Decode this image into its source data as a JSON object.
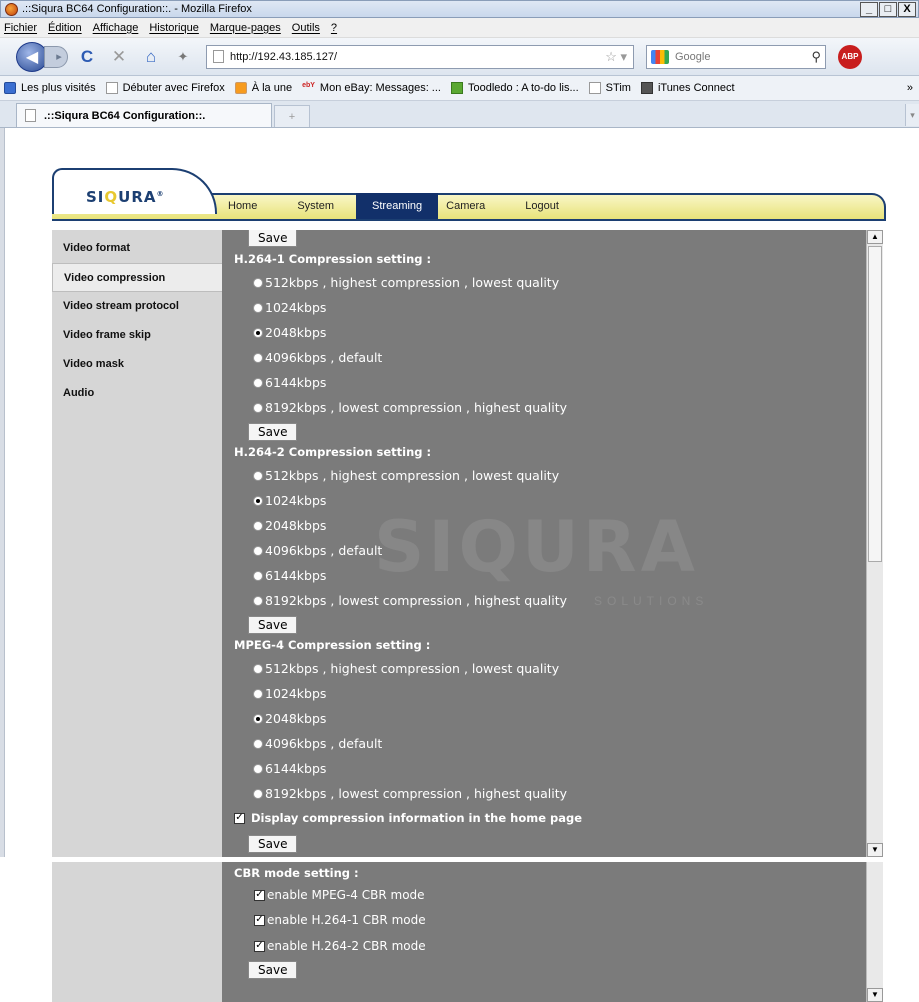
{
  "window": {
    "title": ".::Siqura BC64 Configuration::. - Mozilla Firefox",
    "buttons": [
      "_",
      "□",
      "X"
    ]
  },
  "menu": [
    "Fichier",
    "Édition",
    "Affichage",
    "Historique",
    "Marque-pages",
    "Outils",
    "?"
  ],
  "nav": {
    "url": "http://192.43.185.127/",
    "search_placeholder": "Google",
    "abp": "ABP"
  },
  "bookmarks": [
    "Les plus visités",
    "Débuter avec Firefox",
    "À la une",
    "Mon eBay: Messages: ...",
    "Toodledo : A to-do lis...",
    "STim",
    "iTunes Connect",
    "»"
  ],
  "bookmark_prefix_ebay": "ebY",
  "tab": {
    "title": ".::Siqura BC64 Configuration::.",
    "new_tab": "+"
  },
  "header": {
    "logo_prefix": "SI",
    "logo_q": "Q",
    "logo_suffix": "URA",
    "logo_mark": "®",
    "nav": [
      "Home",
      "System",
      "Streaming",
      "Camera",
      "Logout"
    ],
    "active_nav": "Streaming"
  },
  "sidebar": [
    "Video format",
    "Video compression",
    "Video stream protocol",
    "Video frame skip",
    "Video mask",
    "Audio"
  ],
  "sidebar_active": "Video compression",
  "watermark": {
    "text": "SIQURA",
    "sub": "SOLUTIONS"
  },
  "save_label": "Save",
  "sections": [
    {
      "heading": "H.264-1 Compression setting :",
      "selected": 2,
      "options": [
        "512kbps , highest compression , lowest quality",
        "1024kbps",
        "2048kbps",
        "4096kbps , default",
        "6144kbps",
        "8192kbps , lowest compression , highest quality"
      ]
    },
    {
      "heading": "H.264-2 Compression setting :",
      "selected": 1,
      "options": [
        "512kbps , highest compression , lowest quality",
        "1024kbps",
        "2048kbps",
        "4096kbps , default",
        "6144kbps",
        "8192kbps , lowest compression , highest quality"
      ]
    },
    {
      "heading": "MPEG-4 Compression setting :",
      "selected": 2,
      "options": [
        "512kbps , highest compression , lowest quality",
        "1024kbps",
        "2048kbps",
        "4096kbps , default",
        "6144kbps",
        "8192kbps , lowest compression , highest quality"
      ]
    }
  ],
  "display_info": {
    "label": "Display compression information in the home page",
    "checked": true
  },
  "cbr": {
    "heading": "CBR mode setting :",
    "options": [
      {
        "label": "enable MPEG-4 CBR mode",
        "checked": true
      },
      {
        "label": "enable H.264-1 CBR mode",
        "checked": true
      },
      {
        "label": "enable H.264-2 CBR mode",
        "checked": true
      }
    ]
  },
  "check_mark": "✓"
}
